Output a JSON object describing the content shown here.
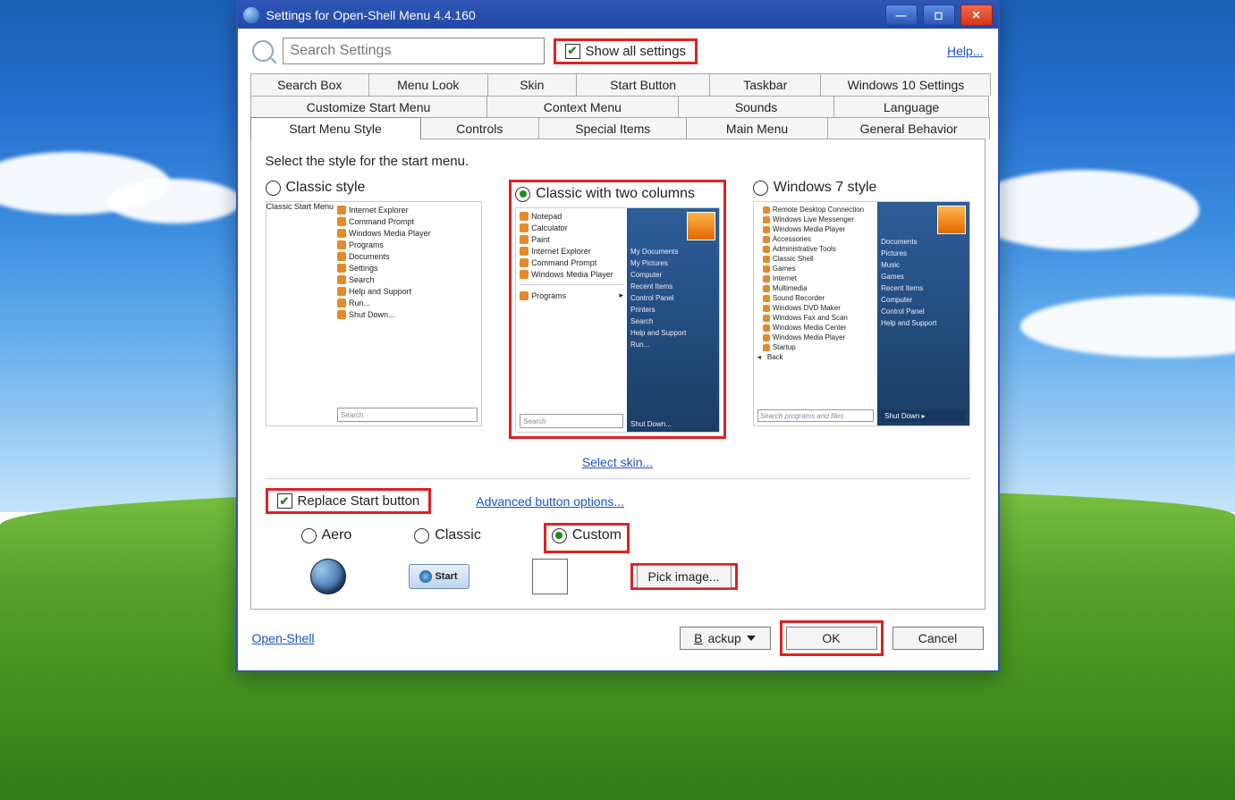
{
  "title": "Settings for Open-Shell Menu 4.4.160",
  "search": {
    "placeholder": "Search Settings"
  },
  "show_all": {
    "label": "Show all settings",
    "checked": true
  },
  "help": "Help...",
  "tabs": {
    "row1": [
      "Search Box",
      "Menu Look",
      "Skin",
      "Start Button",
      "Taskbar",
      "Windows 10 Settings"
    ],
    "row2": [
      "Customize Start Menu",
      "Context Menu",
      "Sounds",
      "Language"
    ],
    "row3": [
      "Start Menu Style",
      "Controls",
      "Special Items",
      "Main Menu",
      "General Behavior"
    ],
    "active": "Start Menu Style"
  },
  "prompt": "Select the style for the start menu.",
  "styles": {
    "classic": {
      "label": "Classic style",
      "selected": false,
      "items": [
        "Internet Explorer",
        "Command Prompt",
        "Windows Media Player",
        "Programs",
        "Documents",
        "Settings",
        "Search",
        "Help and Support",
        "Run...",
        "Shut Down..."
      ],
      "sidebar": "Classic Start Menu",
      "search": "Search"
    },
    "two": {
      "label": "Classic with two columns",
      "selected": true,
      "left": [
        "Notepad",
        "Calculator",
        "Paint",
        "Internet Explorer",
        "Command Prompt",
        "Windows Media Player"
      ],
      "programs": "Programs",
      "search": "Search",
      "right": [
        "My Documents",
        "My Pictures",
        "Computer",
        "Recent Items",
        "Control Panel",
        "Printers",
        "Search",
        "Help and Support",
        "Run...",
        "Shut Down..."
      ]
    },
    "win7": {
      "label": "Windows 7 style",
      "selected": false,
      "left": [
        "Remote Desktop Connection",
        "Windows Live Messenger",
        "Windows Media Player",
        "Accessories",
        "Administrative Tools",
        "Classic Shell",
        "Games",
        "Internet",
        "Multimedia",
        "Sound Recorder",
        "Windows DVD Maker",
        "Windows Fax and Scan",
        "Windows Media Center",
        "Windows Media Player",
        "Startup"
      ],
      "back": "Back",
      "search": "Search programs and files",
      "right": [
        "Documents",
        "Pictures",
        "Music",
        "Games",
        "Recent Items",
        "Computer",
        "Control Panel",
        "Help and Support"
      ],
      "shutdown": "Shut Down"
    }
  },
  "select_skin": "Select skin...",
  "replace": {
    "label": "Replace Start button",
    "checked": true
  },
  "adv": "Advanced button options...",
  "btntype": {
    "aero": "Aero",
    "classic": "Classic",
    "custom": "Custom",
    "selected": "custom"
  },
  "start_label": "Start",
  "pick": "Pick image...",
  "footer": {
    "openshell": "Open-Shell",
    "backup": "Backup",
    "ok": "OK",
    "cancel": "Cancel"
  }
}
